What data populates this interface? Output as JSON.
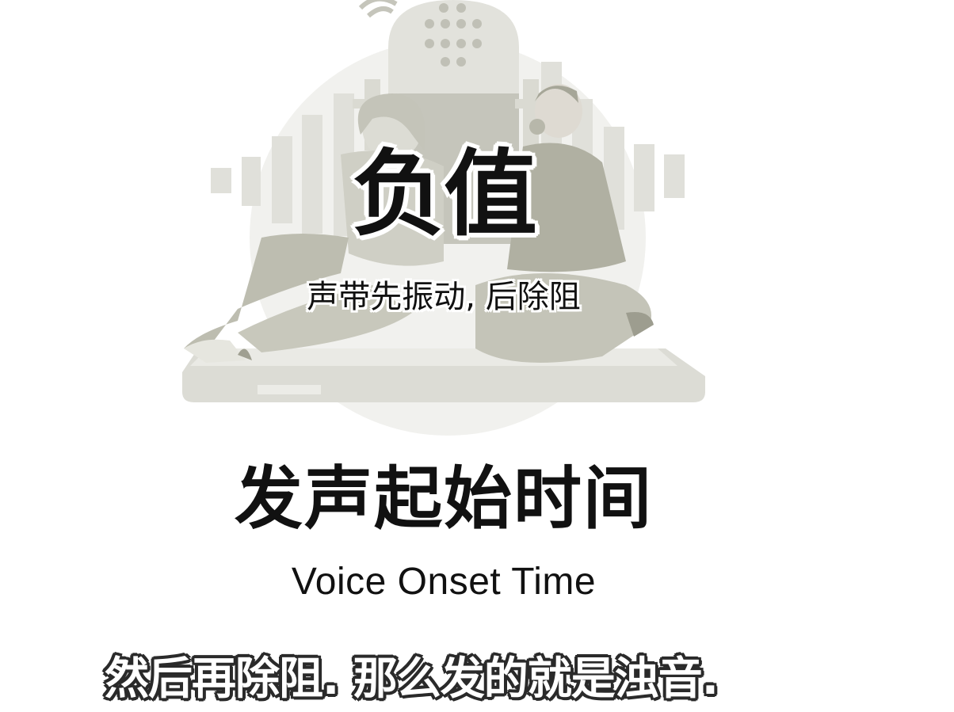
{
  "badge": {
    "title": "负值",
    "subtitle": "声带先振动, 后除阻"
  },
  "heading": {
    "title": "发声起始时间",
    "subtitle": "Voice Onset Time"
  },
  "caption": {
    "text": "然后再除阻. 那么发的就是浊音."
  },
  "colors": {
    "background": "#ffffff",
    "illustration_light": "#e4e4de",
    "illustration_mid": "#c9c9bf",
    "illustration_dark": "#a8a89a",
    "text": "#111111",
    "caption_fill": "#ffffff",
    "caption_outline": "#2a2a2a"
  },
  "icons": {
    "illustration": "podcast-microphone-illustration"
  }
}
